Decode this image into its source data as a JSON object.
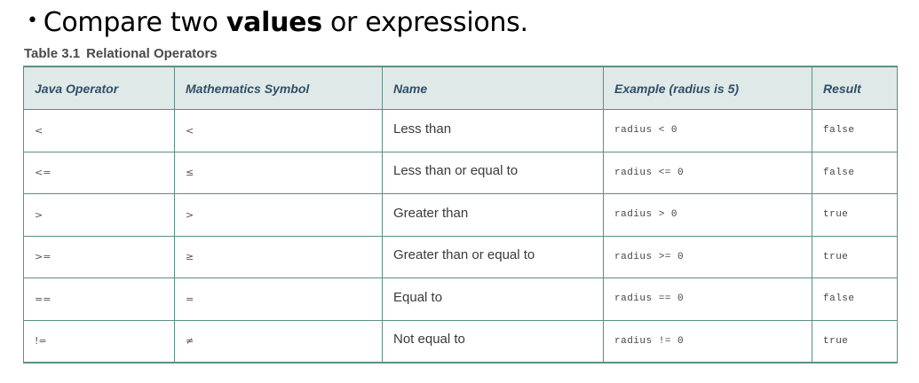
{
  "bullet": {
    "dot": "•",
    "before": "Compare two ",
    "bold": "values",
    "after": " or expressions."
  },
  "table_caption": {
    "number": "Table 3.1",
    "title": "Relational Operators"
  },
  "table": {
    "headers": [
      "Java Operator",
      "Mathematics Symbol",
      "Name",
      "Example (radius is 5)",
      "Result"
    ],
    "rows": [
      [
        "<",
        "<",
        "Less than",
        "radius < 0",
        "false"
      ],
      [
        "<=",
        "≤",
        "Less than or equal to",
        "radius <= 0",
        "false"
      ],
      [
        ">",
        ">",
        "Greater than",
        "radius > 0",
        "true"
      ],
      [
        ">=",
        "≥",
        "Greater than or equal to",
        "radius >= 0",
        "true"
      ],
      [
        "==",
        "=",
        "Equal to",
        "radius == 0",
        "false"
      ],
      [
        "!=",
        "≠",
        "Not equal to",
        "radius != 0",
        "true"
      ]
    ]
  },
  "colors": {
    "header_bg": "#dfe9e7",
    "header_text": "#2f4f69",
    "border": "#5b8f86"
  }
}
